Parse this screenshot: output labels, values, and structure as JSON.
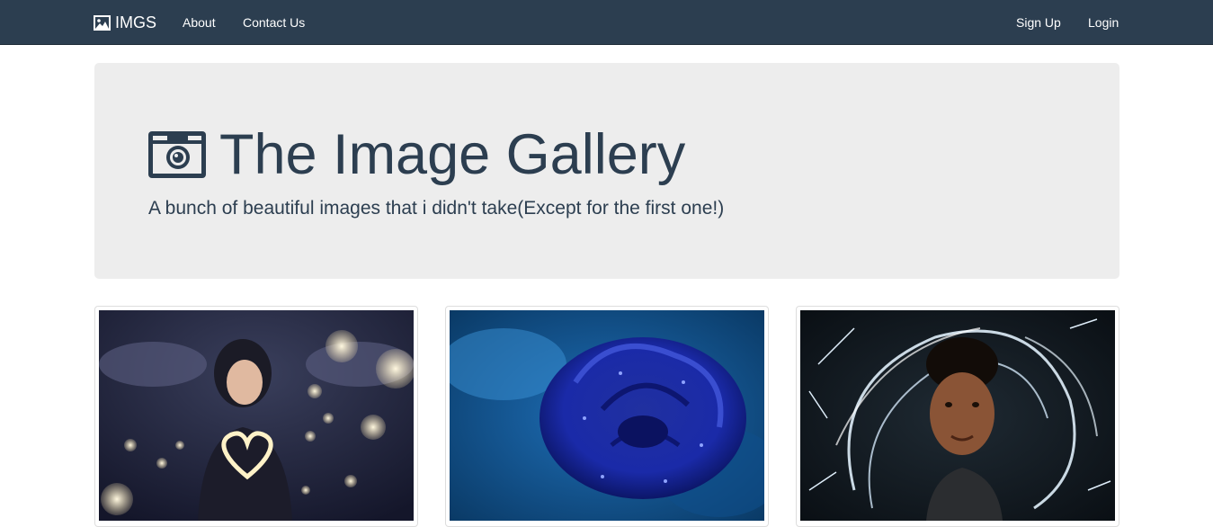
{
  "navbar": {
    "brand": "IMGS",
    "links": [
      {
        "label": "About"
      },
      {
        "label": "Contact Us"
      }
    ],
    "right_links": [
      {
        "label": "Sign Up"
      },
      {
        "label": "Login"
      }
    ],
    "brand_icon": "picture-icon"
  },
  "hero": {
    "title": "The Image Gallery",
    "subtitle": "A bunch of beautiful images that i didn't take(Except for the first one!)",
    "icon": "camera-icon"
  },
  "gallery": {
    "images": [
      {
        "subject": "woman holding heart-shaped light"
      },
      {
        "subject": "blue rose with water droplets"
      },
      {
        "subject": "woman surrounded by sparkler light trails"
      }
    ]
  },
  "colors": {
    "navbar_bg": "#2c3e50",
    "jumbotron_bg": "#ededed",
    "text": "#2c3e50"
  }
}
